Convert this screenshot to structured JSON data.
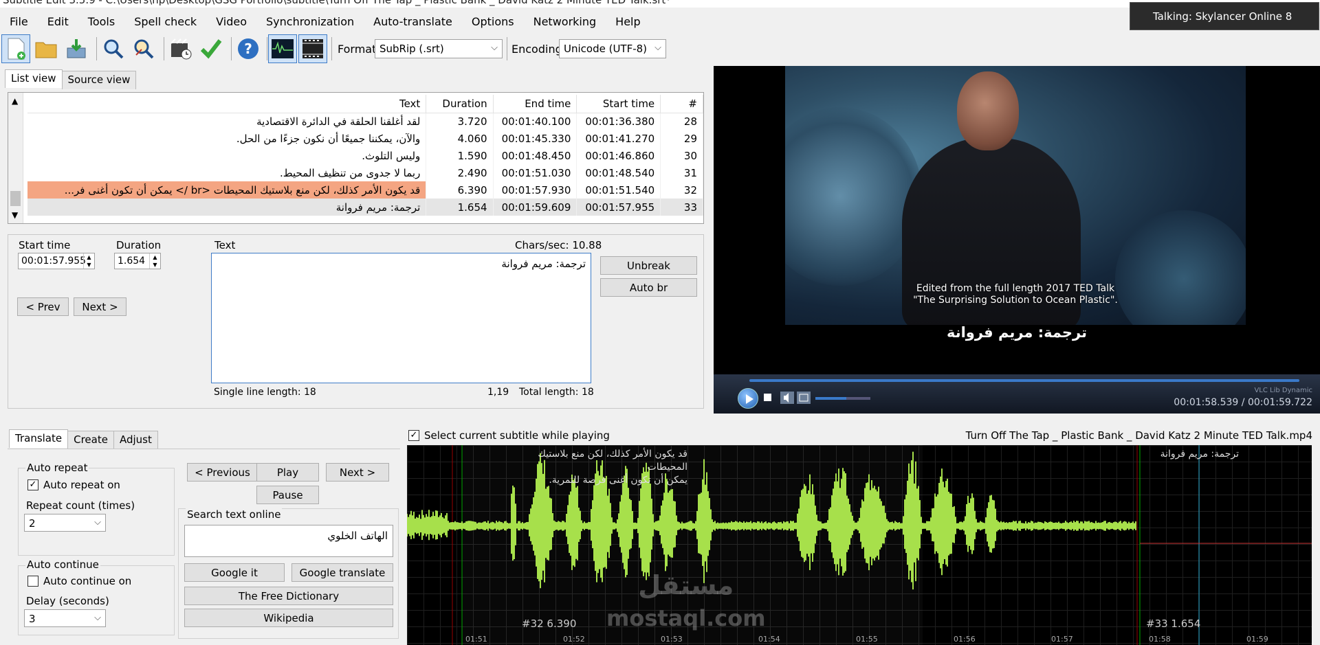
{
  "window_title": "Subtitle Edit 3.5.9 - C:\\Users\\hp\\Desktop\\GSG Portfolio\\subtitle\\Turn Off The Tap  _ Plastic Bank _ David Katz 2 Minute TED Talk.srt*",
  "notification": "Talking: Skylancer Online 8",
  "menu": [
    "File",
    "Edit",
    "Tools",
    "Spell check",
    "Video",
    "Synchronization",
    "Auto-translate",
    "Options",
    "Networking",
    "Help"
  ],
  "toolbar": {
    "format_label": "Format",
    "format_value": "SubRip (.srt)",
    "encoding_label": "Encoding",
    "encoding_value": "Unicode (UTF-8)"
  },
  "view_tabs": [
    "List view",
    "Source view"
  ],
  "grid": {
    "headers": {
      "text": "Text",
      "duration": "Duration",
      "end": "End time",
      "start": "Start time",
      "num": "#"
    },
    "rows": [
      {
        "num": "28",
        "start": "00:01:36.380",
        "end": "00:01:40.100",
        "duration": "3.720",
        "text": "لقد أغلقنا الحلقة في الدائرة الاقتصادية"
      },
      {
        "num": "29",
        "start": "00:01:41.270",
        "end": "00:01:45.330",
        "duration": "4.060",
        "text": "والآن، يمكننا جميعًا أن نكون جزءًا من الحل."
      },
      {
        "num": "30",
        "start": "00:01:46.860",
        "end": "00:01:48.450",
        "duration": "1.590",
        "text": "وليس التلوث."
      },
      {
        "num": "31",
        "start": "00:01:48.540",
        "end": "00:01:51.030",
        "duration": "2.490",
        "text": "ربما لا جدوى من تنظيف المحيط."
      },
      {
        "num": "32",
        "start": "00:01:51.540",
        "end": "00:01:57.930",
        "duration": "6.390",
        "text": "قد يكون الأمر كذلك، لكن منع بلاستيك المحيطات <br /> يمكن أن تكون أغنى فر..."
      },
      {
        "num": "33",
        "start": "00:01:57.955",
        "end": "00:01:59.609",
        "duration": "1.654",
        "text": "ترجمة: مريم فروانة"
      }
    ]
  },
  "editor": {
    "start_time_label": "Start time",
    "start_time_value": "00:01:57.955",
    "duration_label": "Duration",
    "duration_value": "1.654",
    "text_label": "Text",
    "chars_sec": "Chars/sec: 10.88",
    "text_value": "ترجمة: مريم فروانة",
    "prev_label": "< Prev",
    "next_label": "Next >",
    "unbreak_label": "Unbreak",
    "auto_br_label": "Auto br",
    "single_line_length": "Single line length: 18",
    "cursor_pos": "1,19",
    "total_length": "Total length: 18"
  },
  "video": {
    "credit_line1": "Edited from the full length 2017 TED Talk",
    "credit_line2": "\"The Surprising Solution to Ocean Plastic\".",
    "subtitle": "ترجمة: مريم فروانة",
    "time": "00:01:58.539 / 00:01:59.722",
    "brand": "VLC Lib Dynamic",
    "progress": 0.99
  },
  "bottom_tabs": [
    "Translate",
    "Create",
    "Adjust"
  ],
  "translate": {
    "auto_repeat_group": "Auto repeat",
    "auto_repeat_on": "Auto repeat on",
    "repeat_count_label": "Repeat count (times)",
    "repeat_count_value": "2",
    "auto_continue_group": "Auto continue",
    "auto_continue_on": "Auto continue on",
    "delay_label": "Delay (seconds)",
    "delay_value": "3",
    "previous_label": "< Previous",
    "play_label": "Play",
    "next_label": "Next >",
    "pause_label": "Pause",
    "search_online_label": "Search text online",
    "search_value": "الهاتف الخلوي",
    "google_it": "Google it",
    "google_translate": "Google translate",
    "free_dictionary": "The Free Dictionary",
    "wikipedia": "Wikipedia"
  },
  "waveform": {
    "select_while_playing": "Select current subtitle while playing",
    "file_name": "Turn Off The Tap  _ Plastic Bank _ David Katz 2 Minute TED Talk.mp4",
    "sub32_line1": "قد يكون الأمر كذلك، لكن منع بلاستيك المحيطات",
    "sub32_line2": "يمكن أن تكون أغنى فرصة للثمرية.",
    "sub33_text": "ترجمة: مريم فروانة",
    "label32": "#32  6.390",
    "label33": "#33  1.654",
    "ticks": [
      "01:51",
      "01:52",
      "01:53",
      "01:54",
      "01:55",
      "01:56",
      "01:57",
      "01:58",
      "01:59"
    ],
    "watermark_line1": "مستقل",
    "watermark_line2": "mostaql.com",
    "wave_color": "#a7e04b"
  }
}
